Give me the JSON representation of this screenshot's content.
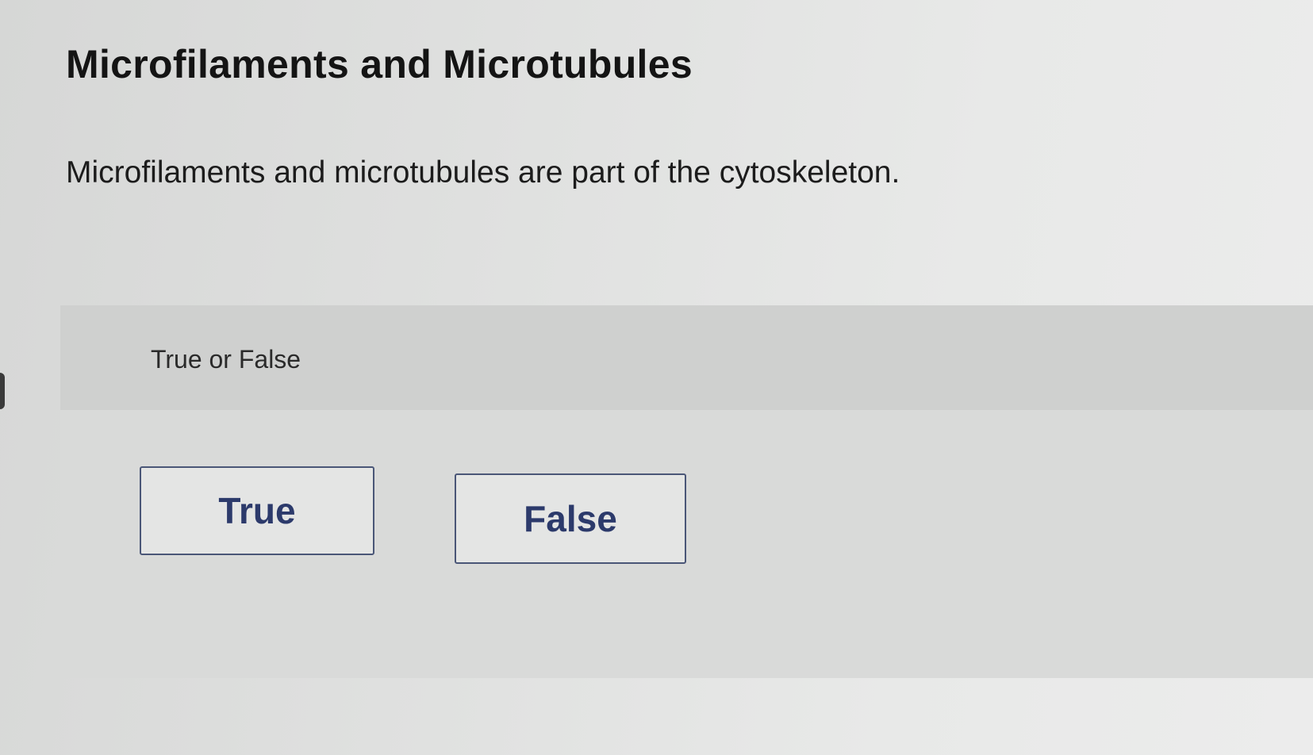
{
  "header": {
    "title": "Microfilaments and Microtubules"
  },
  "question": {
    "text": "Microfilaments and microtubules are part of the cytoskeleton.",
    "prompt": "True or False"
  },
  "choices": {
    "true_label": "True",
    "false_label": "False"
  },
  "colors": {
    "button_text": "#2c3a6b",
    "button_border": "#4a5677",
    "panel_background": "#d9dad9",
    "panel_header_background": "#cfd0cf"
  }
}
